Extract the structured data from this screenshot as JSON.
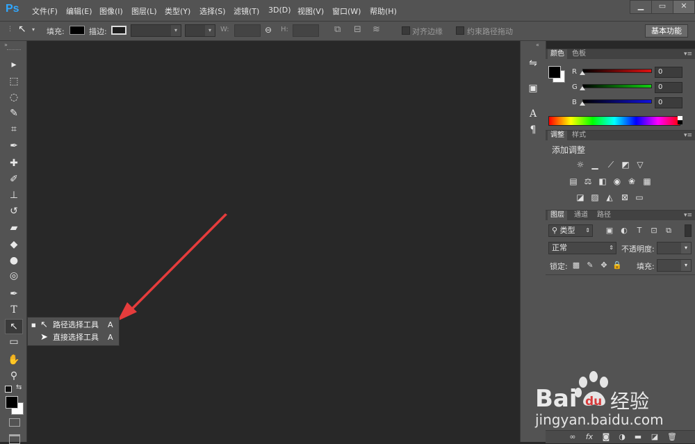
{
  "app": {
    "logo": "Ps"
  },
  "menu": [
    "文件(F)",
    "编辑(E)",
    "图像(I)",
    "图层(L)",
    "类型(Y)",
    "选择(S)",
    "滤镜(T)",
    "3D(D)",
    "视图(V)",
    "窗口(W)",
    "帮助(H)"
  ],
  "window_controls": {
    "minimize": "▁",
    "restore": "▭",
    "close": "✕"
  },
  "options": {
    "fill_label": "填充:",
    "stroke_label": "描边:",
    "w_label": "W:",
    "h_label": "H:",
    "align_edges": "对齐边缘",
    "constrain_path": "约束路径拖动",
    "workspace": "基本功能"
  },
  "tools": [
    {
      "name": "move-tool",
      "glyph": "▸"
    },
    {
      "name": "marquee-tool",
      "glyph": "⬚"
    },
    {
      "name": "lasso-tool",
      "glyph": "◌"
    },
    {
      "name": "quick-select-tool",
      "glyph": "✎"
    },
    {
      "name": "crop-tool",
      "glyph": "⌗"
    },
    {
      "name": "eyedropper-tool",
      "glyph": "✒"
    },
    {
      "name": "healing-brush-tool",
      "glyph": "✚"
    },
    {
      "name": "brush-tool",
      "glyph": "✐"
    },
    {
      "name": "stamp-tool",
      "glyph": "⊥"
    },
    {
      "name": "history-brush-tool",
      "glyph": "↺"
    },
    {
      "name": "eraser-tool",
      "glyph": "▰"
    },
    {
      "name": "paint-bucket-tool",
      "glyph": "◆"
    },
    {
      "name": "blur-tool",
      "glyph": "●"
    },
    {
      "name": "dodge-tool",
      "glyph": "◎"
    },
    {
      "name": "pen-tool",
      "glyph": "✒"
    },
    {
      "name": "type-tool",
      "glyph": "T"
    },
    {
      "name": "path-select-tool",
      "glyph": "↖"
    },
    {
      "name": "rectangle-tool",
      "glyph": "▭"
    },
    {
      "name": "hand-tool",
      "glyph": "✋"
    },
    {
      "name": "zoom-tool",
      "glyph": "⚲"
    }
  ],
  "flyout": {
    "items": [
      {
        "label": "路径选择工具",
        "shortcut": "A",
        "selected": true
      },
      {
        "label": "直接选择工具",
        "shortcut": "A",
        "selected": false
      }
    ]
  },
  "color_panel": {
    "tabs": [
      "颜色",
      "色板"
    ],
    "channels": [
      {
        "label": "R",
        "value": "0",
        "color": "#e01010"
      },
      {
        "label": "G",
        "value": "0",
        "color": "#10d010"
      },
      {
        "label": "B",
        "value": "0",
        "color": "#1010e0"
      }
    ]
  },
  "adjust_panel": {
    "tabs": [
      "调整",
      "样式"
    ],
    "heading": "添加调整"
  },
  "layers_panel": {
    "tabs": [
      "图层",
      "通道",
      "路径"
    ],
    "kind": "类型",
    "blend_mode": "正常",
    "opacity_label": "不透明度:",
    "lock_label": "锁定:",
    "fill_label": "填充:"
  },
  "watermark": {
    "brand": "Bai",
    "brand2": "du",
    "cn": "经验",
    "url": "jingyan.baidu.com"
  }
}
